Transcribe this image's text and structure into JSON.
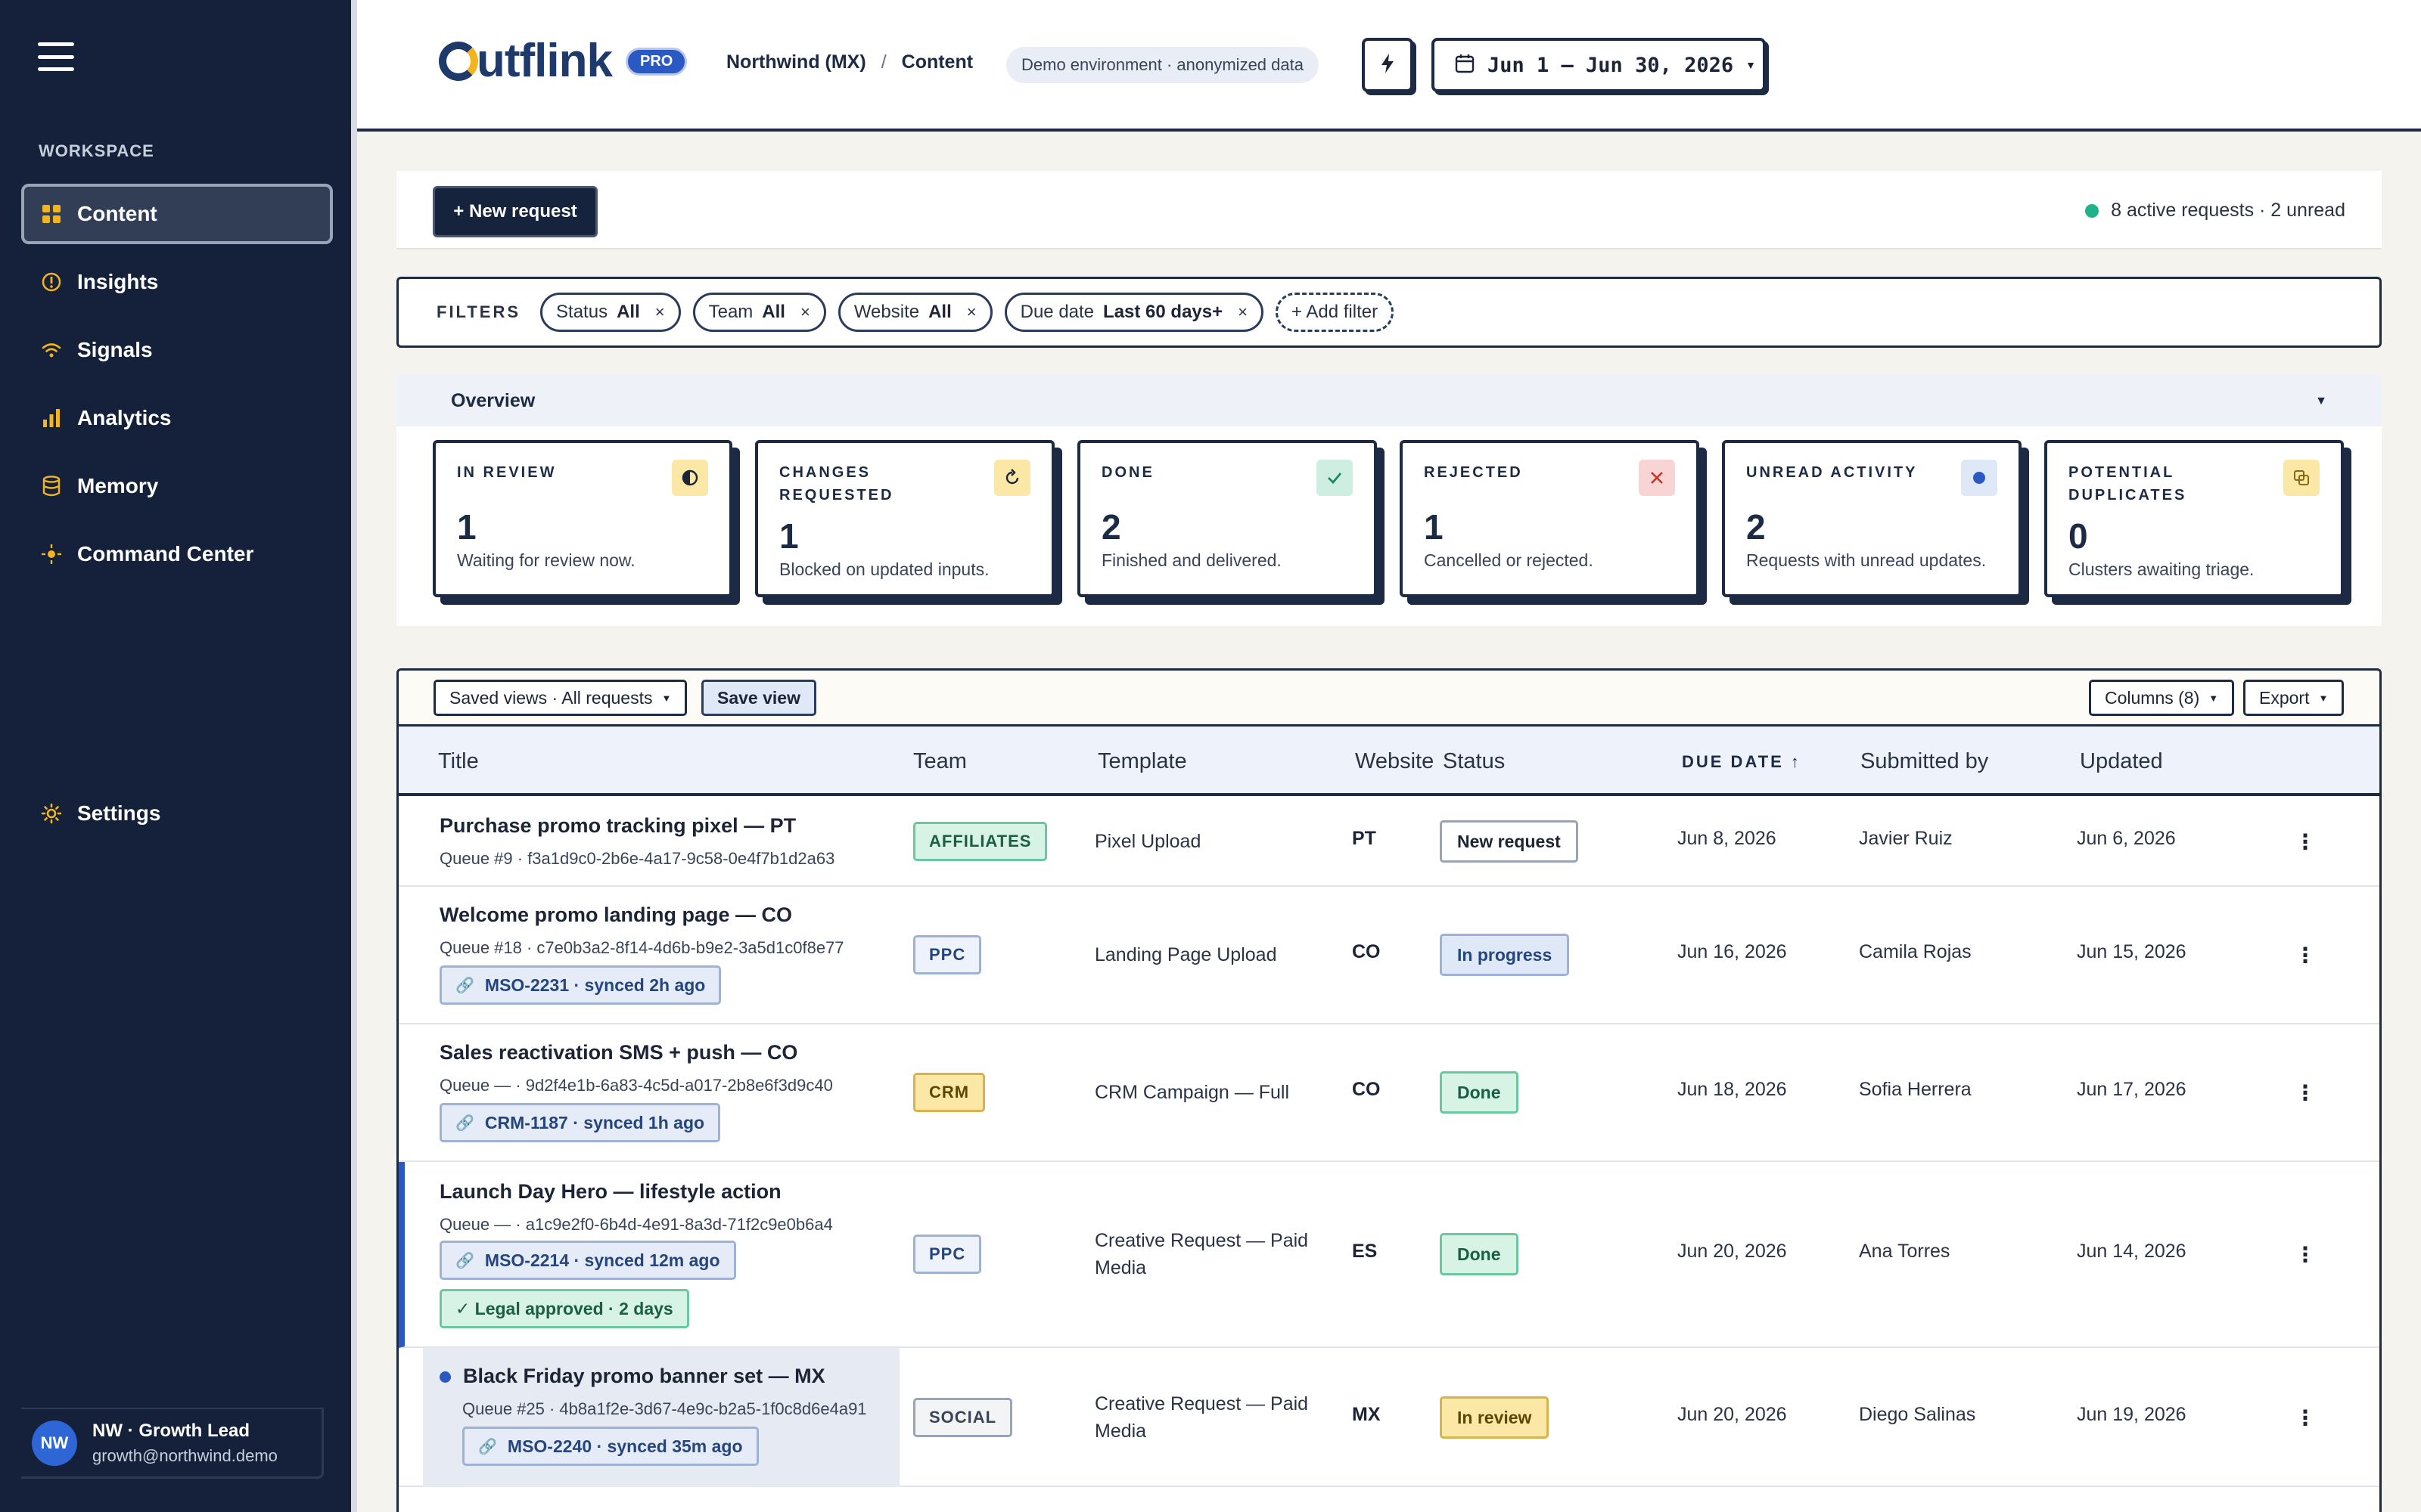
{
  "sidebar": {
    "section_label": "WORKSPACE",
    "items": [
      {
        "label": "Content",
        "icon": "grid-icon"
      },
      {
        "label": "Insights",
        "icon": "info-circle-icon"
      },
      {
        "label": "Signals",
        "icon": "wifi-signal-icon"
      },
      {
        "label": "Analytics",
        "icon": "bar-chart-icon"
      },
      {
        "label": "Memory",
        "icon": "database-icon"
      },
      {
        "label": "Command Center",
        "icon": "crosshair-icon"
      }
    ],
    "settings_label": "Settings",
    "user": {
      "initials": "NW",
      "name": "NW · Growth Lead",
      "email": "growth@northwind.demo"
    }
  },
  "header": {
    "brand": "utflink",
    "badge": "PRO",
    "breadcrumb": [
      "Northwind (MX)",
      "Content"
    ],
    "breadcrumb_sep": "/",
    "env_pill": "Demo environment · anonymized data",
    "date_range": "Jun 1 – Jun 30, 2026"
  },
  "actions": {
    "new_request": "+ New request",
    "active_summary": "8 active requests · 2 unread"
  },
  "filters": {
    "label": "FILTERS",
    "chips": [
      {
        "key": "Status",
        "value": "All"
      },
      {
        "key": "Team",
        "value": "All"
      },
      {
        "key": "Website",
        "value": "All"
      },
      {
        "key": "Due date",
        "value": "Last 60 days+"
      }
    ],
    "add_label": "+ Add filter"
  },
  "overview": {
    "title": "Overview",
    "cards": [
      {
        "title": "IN REVIEW",
        "value": "1",
        "sub": "Waiting for review now."
      },
      {
        "title": "CHANGES REQUESTED",
        "value": "1",
        "sub": "Blocked on updated inputs."
      },
      {
        "title": "DONE",
        "value": "2",
        "sub": "Finished and delivered."
      },
      {
        "title": "REJECTED",
        "value": "1",
        "sub": "Cancelled or rejected."
      },
      {
        "title": "UNREAD ACTIVITY",
        "value": "2",
        "sub": "Requests with unread updates."
      },
      {
        "title": "POTENTIAL DUPLICATES",
        "value": "0",
        "sub": "Clusters awaiting triage."
      }
    ]
  },
  "table": {
    "saved_views": "Saved views · All requests",
    "save_view": "Save view",
    "columns_btn": "Columns (8)",
    "export_btn": "Export",
    "headers": {
      "title": "Title",
      "team": "Team",
      "template": "Template",
      "website": "Website",
      "status": "Status",
      "due": "DUE DATE ↑",
      "by": "Submitted by",
      "updated": "Updated"
    },
    "rows": [
      {
        "title": "Purchase promo tracking pixel — PT",
        "queue": "Queue #9 · f3a1d9c0-2b6e-4a17-9c58-0e4f7b1d2a63",
        "team": "AFFILIATES",
        "template": "Pixel Upload",
        "site": "PT",
        "status": "New request",
        "due": "Jun 8, 2026",
        "by": "Javier Ruiz",
        "updated": "Jun 6, 2026"
      },
      {
        "title": "Welcome promo landing page — CO",
        "queue": "Queue #18 · c7e0b3a2-8f14-4d6b-b9e2-3a5d1c0f8e77",
        "jira": "MSO-2231 · synced 2h ago",
        "team": "PPC",
        "template": "Landing Page Upload",
        "site": "CO",
        "status": "In progress",
        "due": "Jun 16, 2026",
        "by": "Camila Rojas",
        "updated": "Jun 15, 2026"
      },
      {
        "title": "Sales reactivation SMS + push — CO",
        "queue": "Queue — · 9d2f4e1b-6a83-4c5d-a017-2b8e6f3d9c40",
        "jira": "CRM-1187 · synced 1h ago",
        "team": "CRM",
        "template": "CRM Campaign — Full",
        "site": "CO",
        "status": "Done",
        "due": "Jun 18, 2026",
        "by": "Sofia Herrera",
        "updated": "Jun 17, 2026"
      },
      {
        "title": "Launch Day Hero — lifestyle action",
        "queue": "Queue — · a1c9e2f0-6b4d-4e91-8a3d-71f2c9e0b6a4",
        "jira": "MSO-2214 · synced 12m ago",
        "legal": "✓ Legal approved · 2 days",
        "team": "PPC",
        "template": "Creative Request — Paid Media",
        "site": "ES",
        "status": "Done",
        "due": "Jun 20, 2026",
        "by": "Ana Torres",
        "updated": "Jun 14, 2026"
      },
      {
        "title": "Black Friday promo banner set — MX",
        "queue": "Queue #25 · 4b8a1f2e-3d67-4e9c-b2a5-1f0c8d6e4a91",
        "jira": "MSO-2240 · synced 35m ago",
        "team": "SOCIAL",
        "template": "Creative Request — Paid Media",
        "site": "MX",
        "status": "In review",
        "due": "Jun 20, 2026",
        "by": "Diego Salinas",
        "updated": "Jun 19, 2026"
      }
    ]
  },
  "colors": {
    "sidebar_bg": "#15213a",
    "accent_blue": "#2a59c4",
    "brand_yellow": "#f2b51e",
    "ink": "#1c2a44"
  }
}
